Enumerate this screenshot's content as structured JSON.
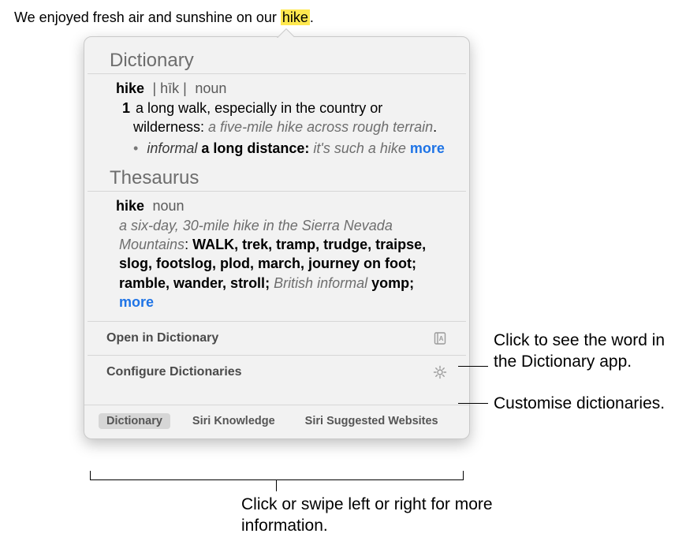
{
  "sentence": {
    "prefix": "We enjoyed fresh air and sunshine on our ",
    "highlighted": "hike",
    "suffix": "."
  },
  "dictionary": {
    "title": "Dictionary",
    "word": "hike",
    "pronunciation": "| hīk |",
    "pos": "noun",
    "def_num": "1",
    "def_text": "a long walk, especially in the country or wilderness: ",
    "def_example": "a five-mile hike across rough terrain",
    "def_period": ".",
    "sub_usage": "informal",
    "sub_text": " a long distance: ",
    "sub_example": "it's such a hike",
    "more": "more"
  },
  "thesaurus": {
    "title": "Thesaurus",
    "word": "hike",
    "pos": "noun",
    "example": "a six-day, 30-mile hike in the Sierra Nevada Mountains",
    "colon": ": ",
    "caps": "WALK",
    "syns": ", trek, tramp, trudge, traipse, slog, footslog, plod, march, journey on foot; ramble, wander, stroll; ",
    "brit": "British informal",
    "brit_syn": " yomp; ",
    "more": "more"
  },
  "rows": {
    "open_label": "Open in Dictionary",
    "configure_label": "Configure Dictionaries"
  },
  "tabs": {
    "dictionary": "Dictionary",
    "siri_knowledge": "Siri Knowledge",
    "siri_websites": "Siri Suggested Websites"
  },
  "callouts": {
    "app": "Click to see the word in the Dictionary app.",
    "customise": "Customise dictionaries.",
    "swipe": "Click or swipe left or right for more information."
  }
}
